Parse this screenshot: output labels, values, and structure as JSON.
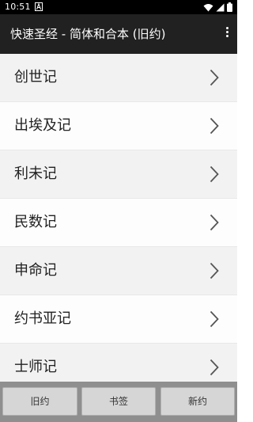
{
  "status_bar": {
    "time": "10:51",
    "app_icon": "a-letter-icon",
    "icons": [
      "wifi-icon",
      "signal-icon",
      "battery-icon"
    ]
  },
  "app_bar": {
    "title": "快速圣经 - 简体和合本 (旧约)",
    "menu_icon": "overflow-menu-icon"
  },
  "books": [
    {
      "label": "创世记"
    },
    {
      "label": "出埃及记"
    },
    {
      "label": "利未记"
    },
    {
      "label": "民数记"
    },
    {
      "label": "申命记"
    },
    {
      "label": "约书亚记"
    },
    {
      "label": "士师记"
    }
  ],
  "bottom_bar": {
    "old_testament": "旧约",
    "bookmarks": "书签",
    "new_testament": "新约"
  },
  "colors": {
    "status_bar": "#000000",
    "app_bar": "#212121",
    "list_row": "#f2f2f2",
    "list_row_alt": "#fdfdfd",
    "bottom_bar": "#8f8f8f",
    "button": "#d6d6d6"
  }
}
